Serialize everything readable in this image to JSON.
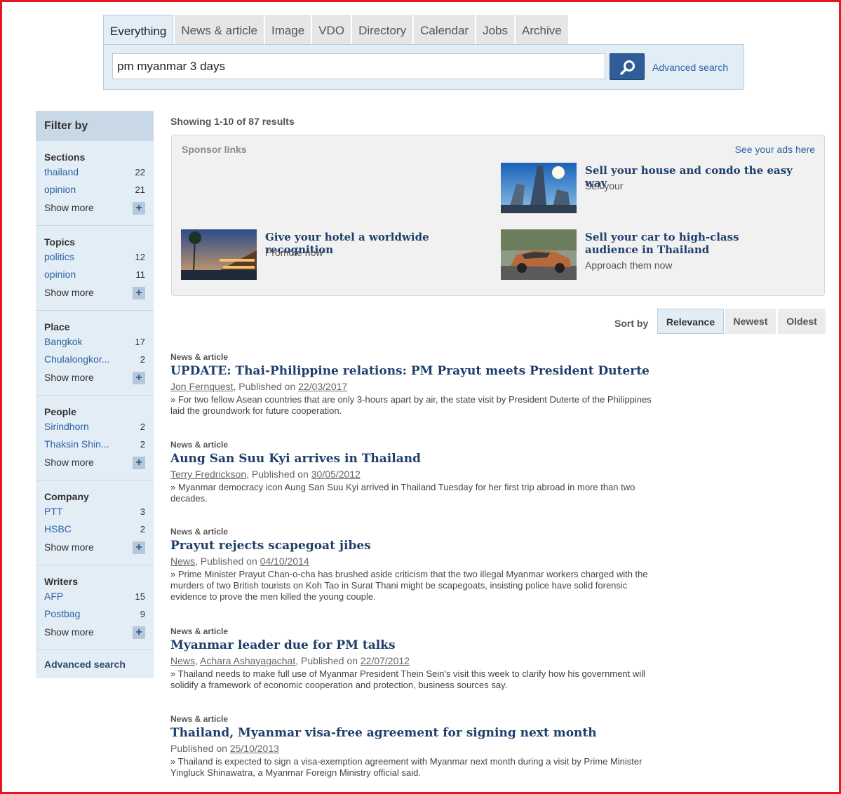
{
  "search": {
    "tabs": [
      "Everything",
      "News & article",
      "Image",
      "VDO",
      "Directory",
      "Calendar",
      "Jobs",
      "Archive"
    ],
    "query": "pm myanmar 3 days",
    "advanced_label": "Advanced search",
    "search_icon": "search-icon"
  },
  "sidebar": {
    "title": "Filter by",
    "show_more": "Show more",
    "groups": [
      {
        "title": "Sections",
        "items": [
          {
            "label": "thailand",
            "count": "22"
          },
          {
            "label": "opinion",
            "count": "21"
          }
        ]
      },
      {
        "title": "Topics",
        "items": [
          {
            "label": "politics",
            "count": "12"
          },
          {
            "label": "opinion",
            "count": "11"
          }
        ]
      },
      {
        "title": "Place",
        "items": [
          {
            "label": "Bangkok",
            "count": "17"
          },
          {
            "label": "Chulalongkor...",
            "count": "2"
          }
        ]
      },
      {
        "title": "People",
        "items": [
          {
            "label": "Sirindhorn",
            "count": "2"
          },
          {
            "label": "Thaksin Shin...",
            "count": "2"
          }
        ]
      },
      {
        "title": "Company",
        "items": [
          {
            "label": "PTT",
            "count": "3"
          },
          {
            "label": "HSBC",
            "count": "2"
          }
        ]
      },
      {
        "title": "Writers",
        "items": [
          {
            "label": "AFP",
            "count": "15"
          },
          {
            "label": "Postbag",
            "count": "9"
          }
        ]
      }
    ],
    "advanced": "Advanced search"
  },
  "main": {
    "showing": "Showing 1-10 of 87 results",
    "sponsor": {
      "title": "Sponsor links",
      "see_ads": "See your ads here",
      "ads": [
        {
          "title": "Sell your house and condo the easy way",
          "sub": "Sell your"
        },
        {
          "title": "Give your hotel a worldwide recognition",
          "sub": "Promote now"
        },
        {
          "title": "Sell your car to high-class audience in Thailand",
          "sub": "Approach them now"
        }
      ]
    },
    "sort": {
      "label": "Sort by",
      "options": [
        "Relevance",
        "Newest",
        "Oldest"
      ],
      "active": "Relevance"
    },
    "results": [
      {
        "type": "News & article",
        "title": "UPDATE: Thai-Philippine relations: PM Prayut meets President Duterte",
        "author": "Jon Fernquest",
        "published_prefix": ", Published on ",
        "date": "22/03/2017",
        "snippet": "» For two fellow Asean countries that are only 3-hours apart by air, the state visit by President Duterte of the Philippines laid the groundwork for future cooperation."
      },
      {
        "type": "News & article",
        "title": "Aung San Suu Kyi arrives in Thailand",
        "author": "Terry Fredrickson",
        "published_prefix": ", Published on ",
        "date": "30/05/2012",
        "snippet": "» Myanmar democracy icon Aung San Suu Kyi arrived in Thailand Tuesday for her first trip abroad in more than two decades."
      },
      {
        "type": "News & article",
        "title": "Prayut rejects scapegoat jibes",
        "author": "News",
        "published_prefix": ", Published on ",
        "date": "04/10/2014",
        "snippet": "» Prime Minister Prayut Chan-o-cha has brushed aside criticism that the two illegal Myanmar workers charged with the murders of two British tourists on Koh Tao in Surat Thani might be scapegoats, insisting police have solid forensic evidence to prove the men killed the young couple."
      },
      {
        "type": "News & article",
        "title": "Myanmar leader due for PM talks",
        "author": "News",
        "author2": "Achara Ashayagachat",
        "published_prefix": ", Published on ",
        "date": "22/07/2012",
        "snippet": "» Thailand needs to make full use of Myanmar President Thein Sein's visit this week to clarify how his government will solidify a framework of economic cooperation and protection, business sources say."
      },
      {
        "type": "News & article",
        "title": "Thailand, Myanmar visa-free agreement for signing next month",
        "published_prefix": "Published on ",
        "date": "25/10/2013",
        "snippet": "» Thailand is expected to sign a visa-exemption agreement with Myanmar next month during a visit by Prime Minister Yingluck Shinawatra, a Myanmar Foreign Ministry official said."
      }
    ]
  }
}
